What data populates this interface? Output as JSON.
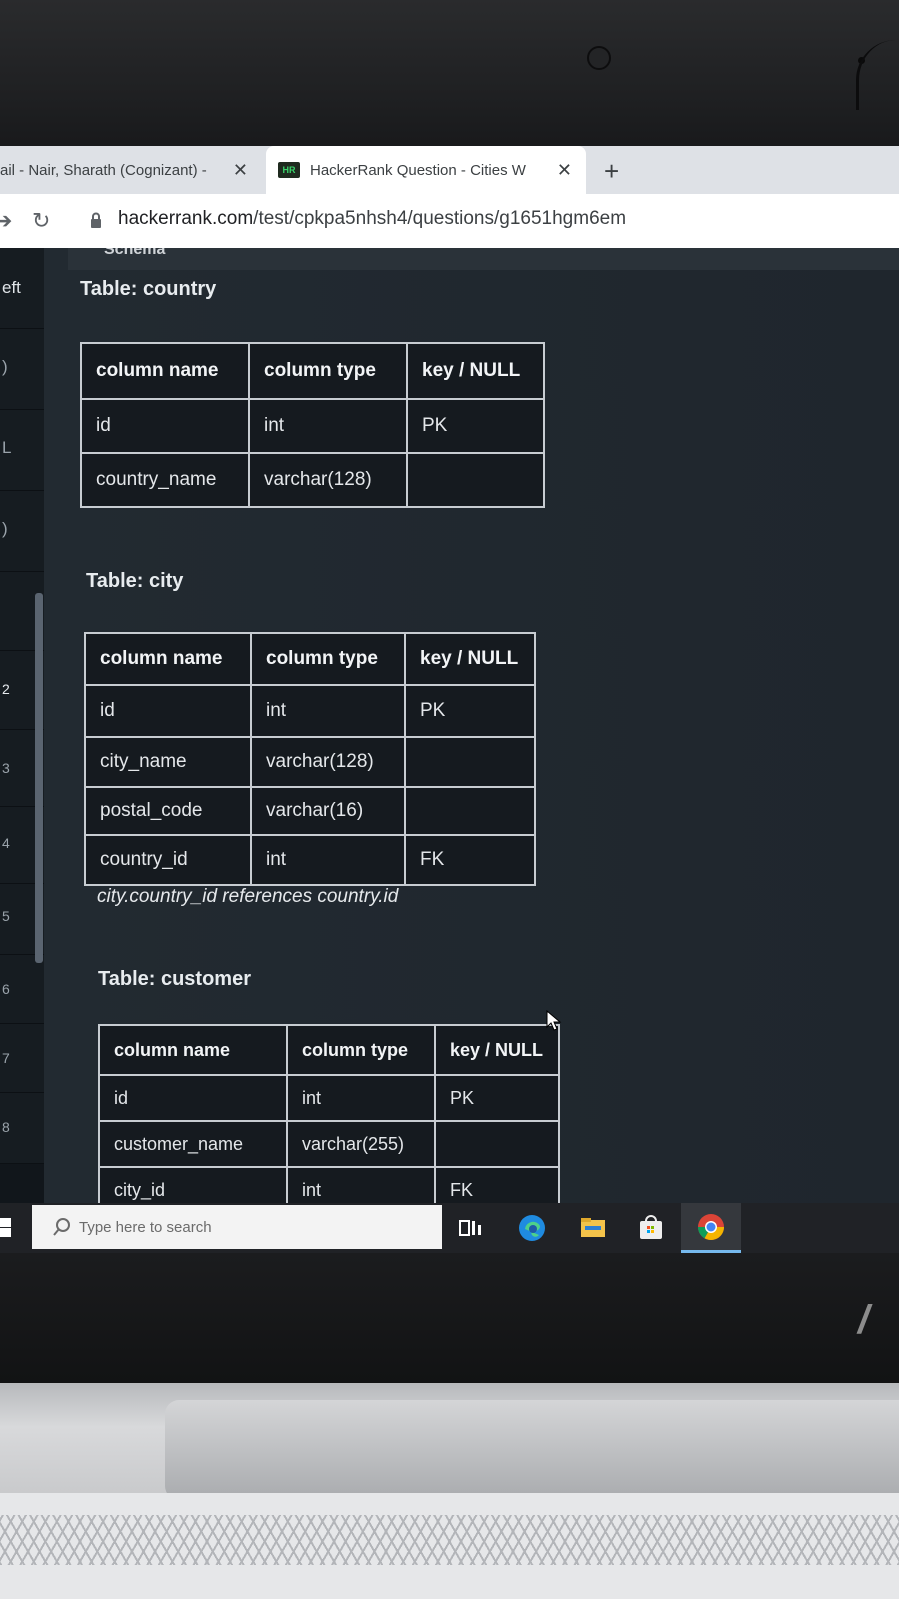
{
  "browser": {
    "tabs": [
      {
        "label": "ail - Nair, Sharath (Cognizant) -",
        "active": false
      },
      {
        "label": "HackerRank Question - Cities W",
        "active": true,
        "favicon": "HR"
      }
    ],
    "new_tab": "+",
    "url": {
      "host": "hackerrank.com",
      "path": "/test/cpkpa5nhsh4/questions/g1651hgm6em"
    }
  },
  "sidebar": {
    "top_label": "eft",
    "numbers": [
      "2",
      "3",
      "4",
      "5",
      "6",
      "7",
      "8"
    ],
    "fragments": [
      ")",
      "L",
      ")"
    ]
  },
  "schema_header": "Schema",
  "tables": [
    {
      "title": "Table: country",
      "headers": [
        "column name",
        "column type",
        "key / NULL"
      ],
      "rows": [
        [
          "id",
          "int",
          "PK"
        ],
        [
          "country_name",
          "varchar(128)",
          ""
        ]
      ]
    },
    {
      "title": "Table: city",
      "headers": [
        "column name",
        "column type",
        "key / NULL"
      ],
      "rows": [
        [
          "id",
          "int",
          "PK"
        ],
        [
          "city_name",
          "varchar(128)",
          ""
        ],
        [
          "postal_code",
          "varchar(16)",
          ""
        ],
        [
          "country_id",
          "int",
          "FK"
        ]
      ],
      "note": "city.country_id references country.id"
    },
    {
      "title": "Table: customer",
      "headers": [
        "column name",
        "column type",
        "key / NULL"
      ],
      "rows": [
        [
          "id",
          "int",
          "PK"
        ],
        [
          "customer_name",
          "varchar(255)",
          ""
        ],
        [
          "city_id",
          "int",
          "FK"
        ]
      ]
    }
  ],
  "taskbar": {
    "search_placeholder": "Type here to search",
    "icons": [
      "windows-start-icon",
      "task-view-icon",
      "edge-icon",
      "file-explorer-icon",
      "store-icon",
      "chrome-icon"
    ]
  }
}
